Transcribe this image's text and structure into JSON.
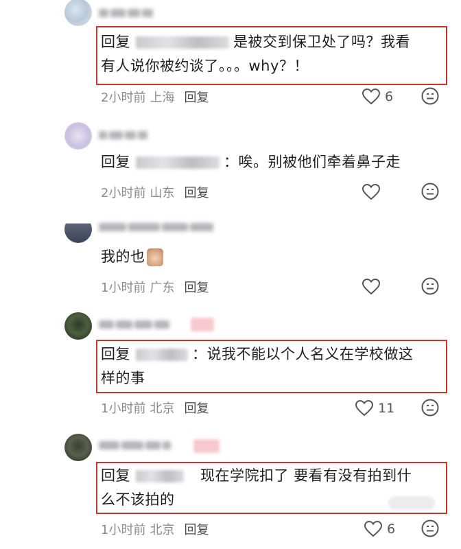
{
  "comments": [
    {
      "text_prefix": "回复",
      "text_line1": "是被交到保卫处了吗？我看",
      "text_line2": "有人说你被约谈了。。。why？！",
      "time": "2小时前",
      "location": "上海",
      "reply_label": "回复",
      "likes": "6"
    },
    {
      "text_prefix": "回复",
      "text_line1": "：唉。别被他们牵着鼻子走",
      "time": "2小时前",
      "location": "山东",
      "reply_label": "回复"
    },
    {
      "text_line1": "我的也",
      "time": "1小时前",
      "location": "广东",
      "reply_label": "回复"
    },
    {
      "text_prefix": "回复",
      "text_line1": "：说我不能以个人名义在学校做这",
      "text_line2": "样的事",
      "time": "1小时前",
      "location": "北京",
      "reply_label": "回复",
      "likes": "11"
    },
    {
      "text_prefix": "回复",
      "text_line1": "现在学院扣了 要看有没有拍到什",
      "text_line2": "么不该拍的",
      "time": "1小时前",
      "location": "北京",
      "reply_label": "回复",
      "likes": "6"
    }
  ],
  "icons": {
    "like": "heart-outline-icon",
    "dislike": "meh-face-icon"
  },
  "colors": {
    "highlight_box": "#c8332c",
    "meta_text": "#8a8a8a"
  }
}
